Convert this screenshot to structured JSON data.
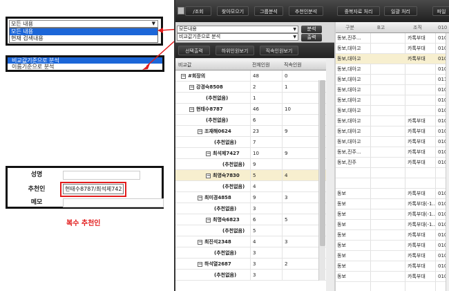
{
  "left": {
    "dropdown1": {
      "value": "모든 내용",
      "options": [
        {
          "label": "모든 내용",
          "selected": true
        },
        {
          "label": "현재 검색내용",
          "selected": false
        }
      ]
    },
    "dropdown2": {
      "options": [
        {
          "label": "비교값기준으로 분석",
          "selected": true
        },
        {
          "label": "이름기준으로 분석",
          "selected": false
        }
      ]
    },
    "form": {
      "name_label": "성명",
      "recommender_label": "추천인",
      "recommender_value": "현태수8787/최석제742",
      "memo_label": "메모"
    },
    "caption": "복수 추천인"
  },
  "app": {
    "toolbar": {
      "buttons": [
        "/조회",
        "찾아모으기",
        "그룹분석",
        "추천인분석",
        "중복자료 처리",
        "일괄 처리",
        "파일"
      ]
    },
    "subbar": {
      "select1": "모든내용",
      "select2": "비교값기준으로 분석",
      "btn_analyze": "분석",
      "btn_print": "출력"
    },
    "buttons": [
      "선택출력",
      "하위인원보기",
      "직속인원보기"
    ],
    "tree": {
      "headers": [
        "비교값",
        "전체인원",
        "직속인원"
      ],
      "rows": [
        {
          "name": "#회장의",
          "total": "48",
          "direct": "0",
          "indent": 0
        },
        {
          "name": "강경숙8508",
          "total": "2",
          "direct": "1",
          "indent": 1
        },
        {
          "name": "(추천없음)",
          "total": "1",
          "direct": "",
          "indent": 2
        },
        {
          "name": "현태수8787",
          "total": "46",
          "direct": "10",
          "indent": 1
        },
        {
          "name": "(추천없음)",
          "total": "6",
          "direct": "",
          "indent": 2
        },
        {
          "name": "조재해0624",
          "total": "23",
          "direct": "9",
          "indent": 2
        },
        {
          "name": "(추천없음)",
          "total": "7",
          "direct": "",
          "indent": 3
        },
        {
          "name": "최석제7427",
          "total": "10",
          "direct": "9",
          "indent": 3
        },
        {
          "name": "(추천없음)",
          "total": "9",
          "direct": "",
          "indent": 4
        },
        {
          "name": "최영숙7830",
          "total": "5",
          "direct": "4",
          "indent": 3,
          "highlight": true
        },
        {
          "name": "(추천없음)",
          "total": "4",
          "direct": "",
          "indent": 4
        },
        {
          "name": "최미경4858",
          "total": "9",
          "direct": "3",
          "indent": 2
        },
        {
          "name": "(추천없음)",
          "total": "3",
          "direct": "",
          "indent": 3
        },
        {
          "name": "최명숙6823",
          "total": "6",
          "direct": "5",
          "indent": 3
        },
        {
          "name": "(추천없음)",
          "total": "5",
          "direct": "",
          "indent": 4
        },
        {
          "name": "최진석2348",
          "total": "4",
          "direct": "3",
          "indent": 2
        },
        {
          "name": "(추천없음)",
          "total": "3",
          "direct": "",
          "indent": 3
        },
        {
          "name": "하석열2687",
          "total": "3",
          "direct": "2",
          "indent": 2
        },
        {
          "name": "(추천없음)",
          "total": "3",
          "direct": "",
          "indent": 3
        }
      ]
    },
    "grid": {
      "headers": [
        "구분",
        "B고",
        "조직",
        "010"
      ],
      "rows": [
        {
          "a": "동보,진주...",
          "b": "",
          "c": "카톡부대",
          "d": "010",
          "hl": false
        },
        {
          "a": "동보,대아고",
          "b": "",
          "c": "카톡부대",
          "d": "010",
          "hl": false
        },
        {
          "a": "동보,대아고",
          "b": "",
          "c": "카톡부대",
          "d": "010",
          "hl": true
        },
        {
          "a": "동보,대아고",
          "b": "",
          "c": "",
          "d": "010",
          "hl": false
        },
        {
          "a": "동보,대아고",
          "b": "",
          "c": "",
          "d": "011",
          "hl": false
        },
        {
          "a": "동보,대아고",
          "b": "",
          "c": "",
          "d": "010",
          "hl": false
        },
        {
          "a": "동보,대아고",
          "b": "",
          "c": "",
          "d": "010",
          "hl": false
        },
        {
          "a": "동보,대아고",
          "b": "",
          "c": "",
          "d": "010",
          "hl": false
        },
        {
          "a": "동보,대아고",
          "b": "",
          "c": "카톡부대",
          "d": "010",
          "hl": false
        },
        {
          "a": "동보,대아고",
          "b": "",
          "c": "카톡부대",
          "d": "010",
          "hl": false
        },
        {
          "a": "동보,대아고",
          "b": "",
          "c": "카톡부대",
          "d": "010",
          "hl": false
        },
        {
          "a": "동보,진주...",
          "b": "",
          "c": "카톡부대",
          "d": "010",
          "hl": false
        },
        {
          "a": "동보,진주",
          "b": "",
          "c": "카톡부대",
          "d": "010",
          "hl": false
        },
        {
          "a": "",
          "b": "",
          "c": "",
          "d": "",
          "hl": false
        },
        {
          "a": "",
          "b": "",
          "c": "",
          "d": "",
          "hl": false
        },
        {
          "a": "동보",
          "b": "",
          "c": "카톡부대",
          "d": "010",
          "hl": false
        },
        {
          "a": "동보",
          "b": "",
          "c": "카톡부대(-1...",
          "d": "010",
          "hl": false
        },
        {
          "a": "동보",
          "b": "",
          "c": "카톡부대(-1...",
          "d": "010",
          "hl": false
        },
        {
          "a": "동보",
          "b": "",
          "c": "카톡부대(-1...",
          "d": "010",
          "hl": false
        },
        {
          "a": "동보",
          "b": "",
          "c": "카톡부대",
          "d": "010",
          "hl": false
        },
        {
          "a": "동보",
          "b": "",
          "c": "카톡부대",
          "d": "010",
          "hl": false
        },
        {
          "a": "동보",
          "b": "",
          "c": "카톡부대",
          "d": "010",
          "hl": false
        },
        {
          "a": "동보",
          "b": "",
          "c": "카톡부대",
          "d": "010",
          "hl": false
        },
        {
          "a": "동보",
          "b": "",
          "c": "카톡부대",
          "d": "010",
          "hl": false
        }
      ]
    }
  }
}
